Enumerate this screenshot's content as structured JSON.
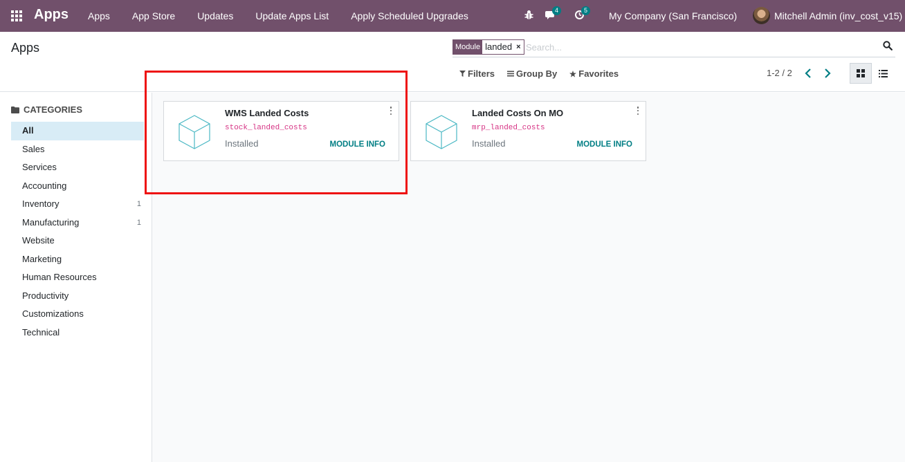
{
  "navbar": {
    "brand": "Apps",
    "menu": [
      "Apps",
      "App Store",
      "Updates",
      "Update Apps List",
      "Apply Scheduled Upgrades"
    ],
    "messages_count": "4",
    "activities_count": "5",
    "company": "My Company (San Francisco)",
    "user": "Mitchell Admin (inv_cost_v15)",
    "icons": [
      "apps-grid-icon",
      "bug-icon",
      "chat-icon",
      "clock-icon"
    ]
  },
  "control_panel": {
    "title": "Apps",
    "search": {
      "facet_label": "Module",
      "facet_value": "landed",
      "facet_remove": "×",
      "placeholder": "Search..."
    },
    "filters_label": "Filters",
    "group_by_label": "Group By",
    "favorites_label": "Favorites",
    "pager": "1-2 / 2"
  },
  "sidebar": {
    "header": "CATEGORIES",
    "items": [
      {
        "label": "All",
        "count": "",
        "active": true
      },
      {
        "label": "Sales",
        "count": ""
      },
      {
        "label": "Services",
        "count": ""
      },
      {
        "label": "Accounting",
        "count": ""
      },
      {
        "label": "Inventory",
        "count": "1"
      },
      {
        "label": "Manufacturing",
        "count": "1"
      },
      {
        "label": "Website",
        "count": ""
      },
      {
        "label": "Marketing",
        "count": ""
      },
      {
        "label": "Human Resources",
        "count": ""
      },
      {
        "label": "Productivity",
        "count": ""
      },
      {
        "label": "Customizations",
        "count": ""
      },
      {
        "label": "Technical",
        "count": ""
      }
    ]
  },
  "cards": [
    {
      "title": "WMS Landed Costs",
      "technical_name": "stock_landed_costs",
      "status": "Installed",
      "action": "MODULE INFO"
    },
    {
      "title": "Landed Costs On MO",
      "technical_name": "mrp_landed_costs",
      "status": "Installed",
      "action": "MODULE INFO"
    }
  ],
  "colors": {
    "navbar": "#71506b",
    "accent": "#017e84",
    "highlight": "#ee1111",
    "technical_name": "#d63384"
  }
}
